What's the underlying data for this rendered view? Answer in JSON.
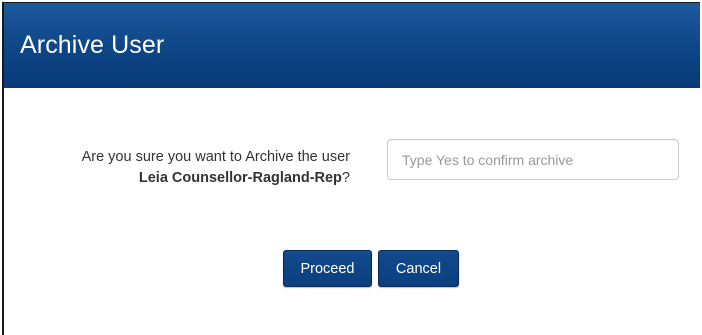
{
  "dialog": {
    "title": "Archive User",
    "message_prefix": "Are you sure you want to Archive the user ",
    "username": "Leia Counsellor-Ragland-Rep",
    "message_suffix": "?",
    "confirm_input": {
      "value": "",
      "placeholder": "Type Yes to confirm archive"
    },
    "proceed_label": "Proceed",
    "cancel_label": "Cancel"
  },
  "colors": {
    "header_bg": "#0e4586",
    "button_bg": "#0b3f7e",
    "text": "#333333"
  }
}
